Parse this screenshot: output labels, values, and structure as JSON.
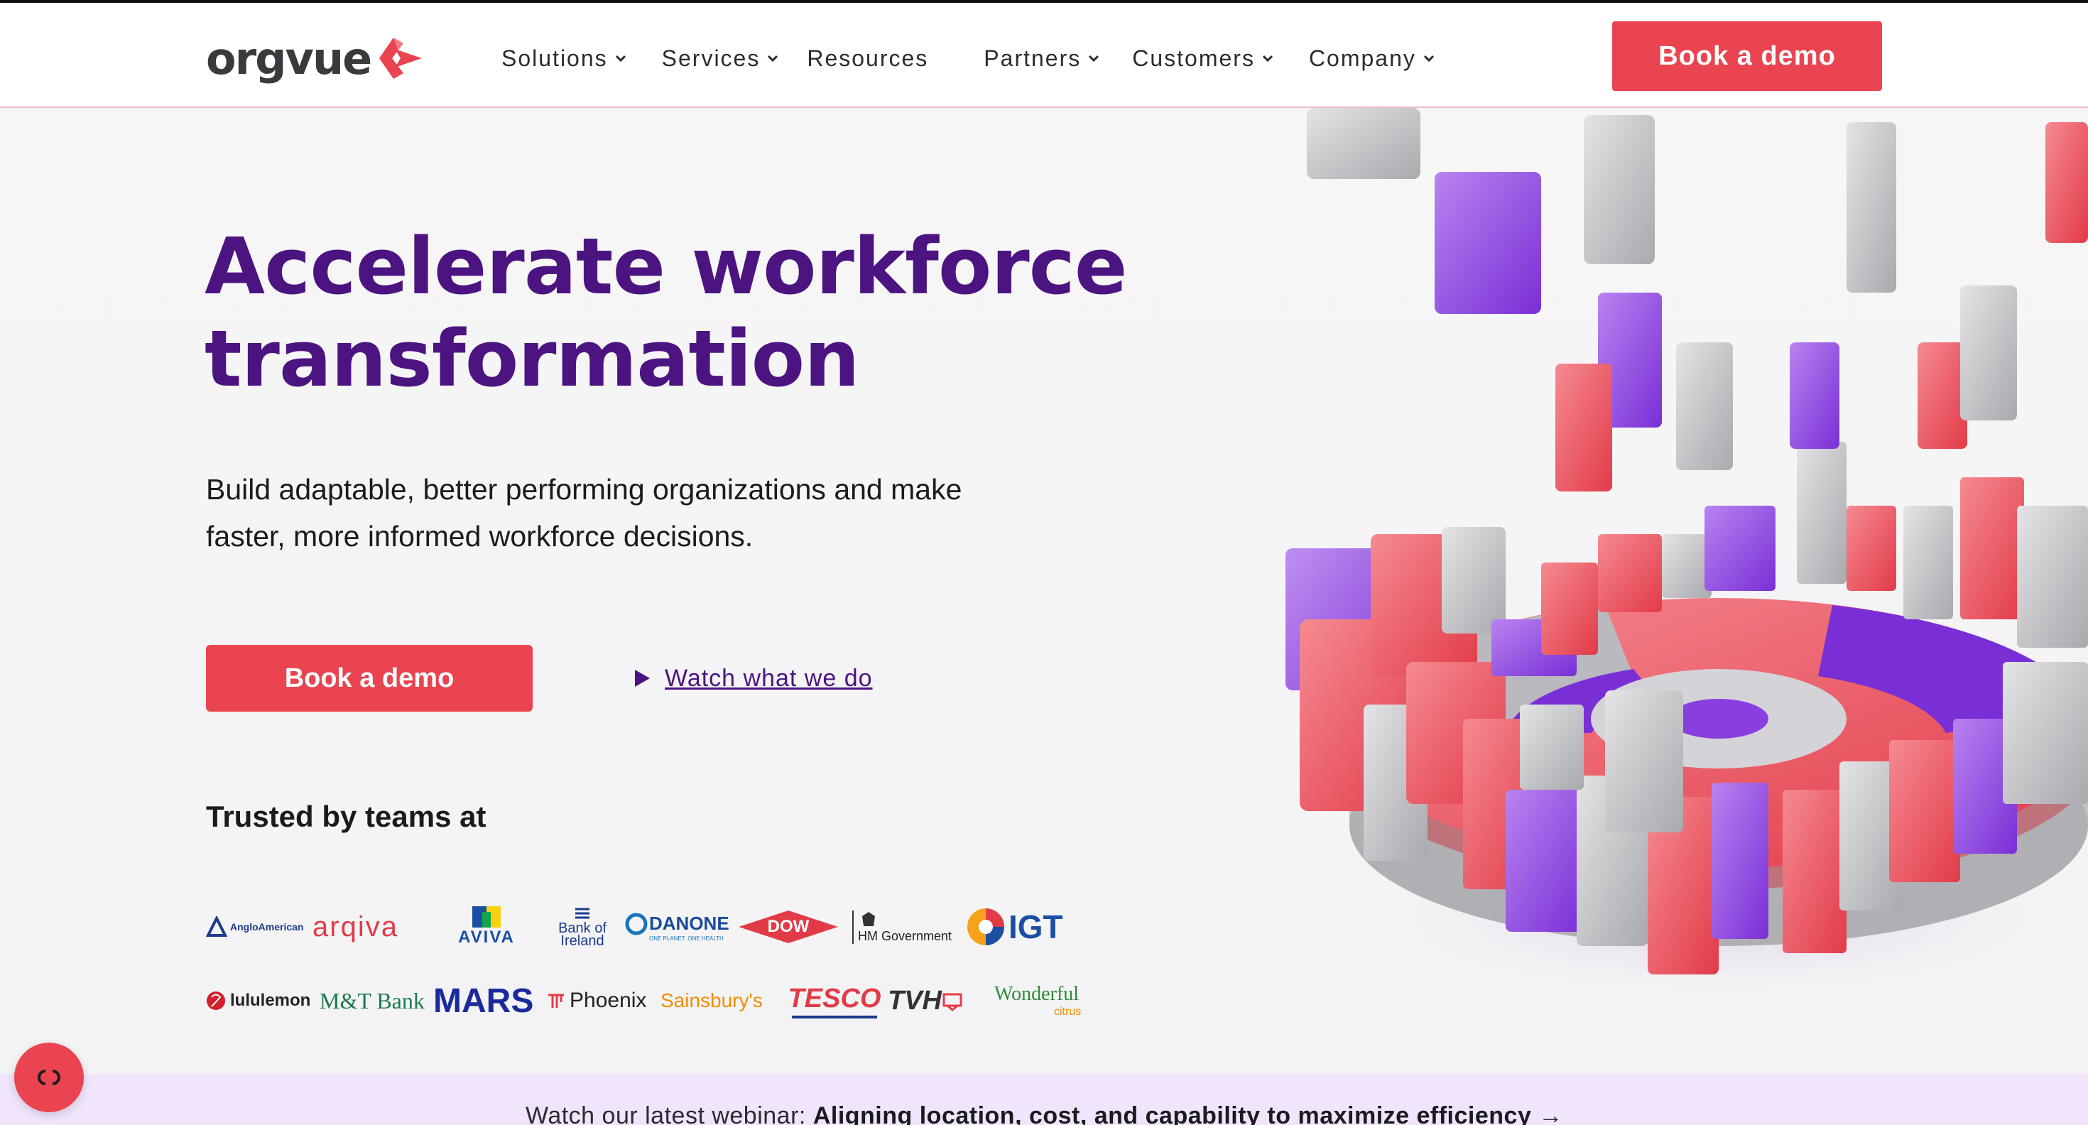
{
  "header": {
    "logo_text": "orgvue",
    "nav": [
      {
        "label": "Solutions",
        "dropdown": true
      },
      {
        "label": "Services",
        "dropdown": true
      },
      {
        "label": "Resources",
        "dropdown": false
      },
      {
        "label": "Partners",
        "dropdown": true
      },
      {
        "label": "Customers",
        "dropdown": true
      },
      {
        "label": "Company",
        "dropdown": true
      }
    ],
    "cta_label": "Book a demo"
  },
  "hero": {
    "title_line1": "Accelerate workforce",
    "title_line2": "transformation",
    "subtitle_line1": "Build adaptable, better performing organizations and make",
    "subtitle_line2": "faster, more informed workforce decisions.",
    "cta_label": "Book a demo",
    "watch_label": "Watch what we do",
    "trusted_heading": "Trusted by teams at"
  },
  "customers": {
    "row1": [
      "AngloAmerican",
      "arqiva",
      "AVIVA",
      "Bank of Ireland",
      "DANONE",
      "DOW",
      "HM Government",
      "IGT"
    ],
    "row2": [
      "lululemon",
      "M&T Bank",
      "MARS",
      "Phoenix",
      "Sainsbury's",
      "TESCO",
      "TVH",
      "Wonderful"
    ],
    "danone_tagline": "ONE PLANET. ONE HEALTH",
    "wonderful_sub": "citrus"
  },
  "banner": {
    "prefix": "Watch our latest webinar:",
    "title": "Aligning location, cost, and capability to maximize efficiency",
    "arrow": "→"
  },
  "colors": {
    "brand_purple": "#4c1480",
    "brand_red": "#e9444f",
    "banner_bg": "#f0e5fb"
  },
  "icons": {
    "nav_chevron": "chevron-down-icon",
    "watch": "play-icon",
    "chat": "chat-icon"
  }
}
